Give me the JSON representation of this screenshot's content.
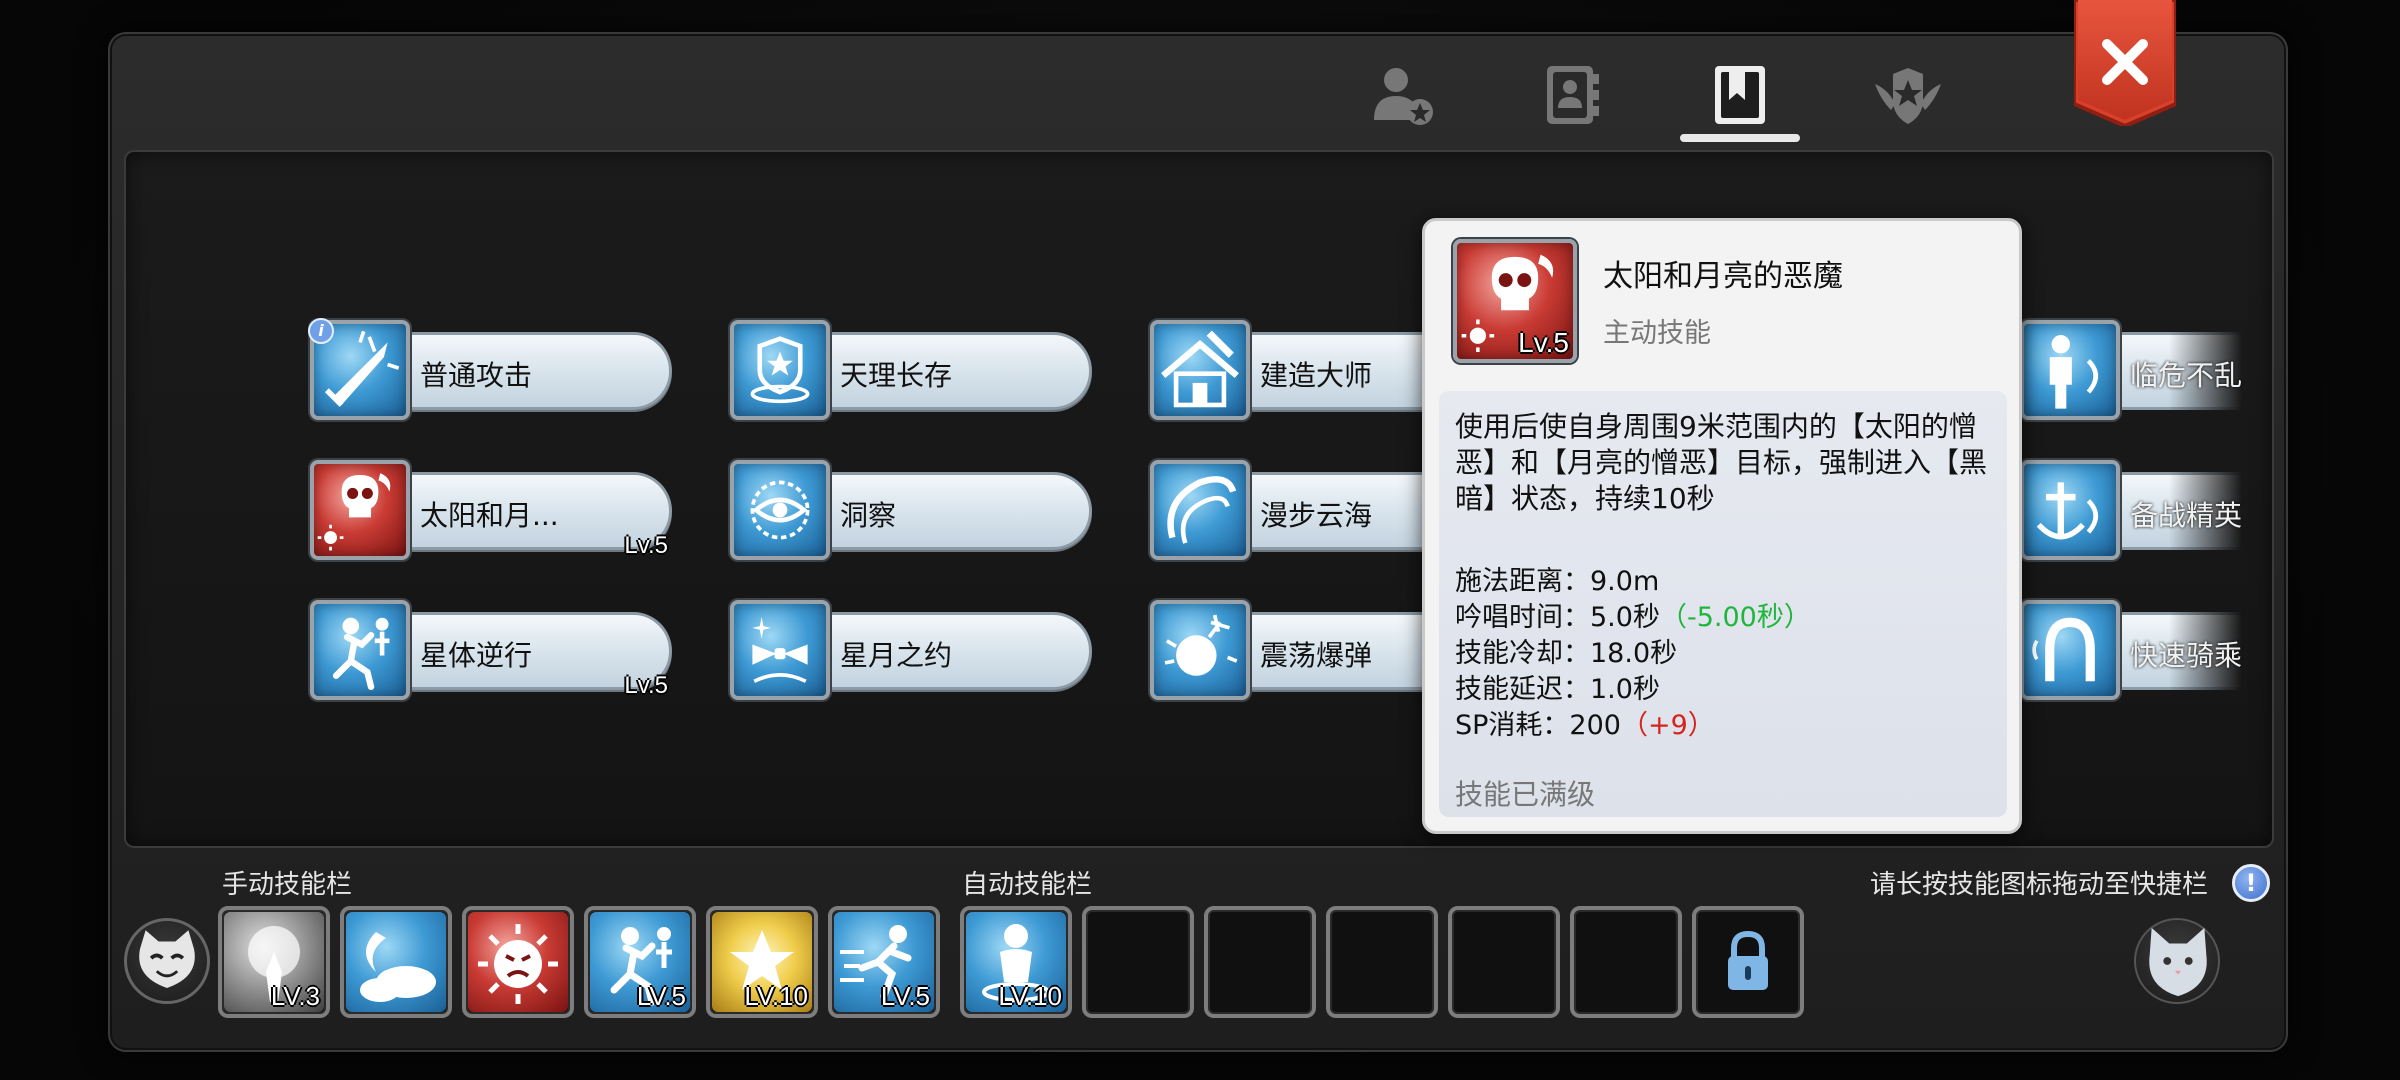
{
  "tabs": [
    {
      "icon": "person-star-icon"
    },
    {
      "icon": "contacts-book-icon"
    },
    {
      "icon": "bookmark-book-icon",
      "active": true
    },
    {
      "icon": "winged-emblem-icon"
    }
  ],
  "close_icon": "close-icon",
  "skills": [
    {
      "name": "普通攻击",
      "icon": "sword-burst-icon",
      "color": "blue",
      "level": "",
      "info": "i"
    },
    {
      "name": "天理长存",
      "icon": "star-shield-icon",
      "color": "blue",
      "level": ""
    },
    {
      "name": "建造大师",
      "icon": "house-hammer-icon",
      "color": "blue",
      "level": ""
    },
    {
      "name": "太阳和月...",
      "icon": "skull-moon-icon",
      "color": "red",
      "level": "Lv.5"
    },
    {
      "name": "洞察",
      "icon": "eye-burst-icon",
      "color": "blue",
      "level": ""
    },
    {
      "name": "漫步云海",
      "icon": "cloud-swirl-icon",
      "color": "blue",
      "level": ""
    },
    {
      "name": "星体逆行",
      "icon": "running-figure-icon",
      "color": "blue",
      "level": "Lv.5"
    },
    {
      "name": "星月之约",
      "icon": "bow-sparkle-icon",
      "color": "blue",
      "level": ""
    },
    {
      "name": "震荡爆弹",
      "icon": "bomb-burst-icon",
      "color": "blue",
      "level": ""
    },
    {
      "name": "临危不乱",
      "icon": "standing-figure-icon",
      "color": "blue",
      "level": ""
    },
    {
      "name": "备战精英",
      "icon": "anchor-swirl-icon",
      "color": "blue",
      "level": ""
    },
    {
      "name": "快速骑乘",
      "icon": "horseshoe-icon",
      "color": "blue",
      "level": ""
    }
  ],
  "tooltip": {
    "title": "太阳和月亮的恶魔",
    "type": "主动技能",
    "level": "Lv.5",
    "description": "使用后使自身周围9米范围内的【太阳的憎恶】和【月亮的憎恶】目标，强制进入【黑暗】状态，持续10秒",
    "cast_range_label": "施法距离：",
    "cast_range_value": "9.0m",
    "chant_label": "吟唱时间：",
    "chant_value": "5.0秒",
    "chant_bonus": "（-5.00秒）",
    "cooldown_label": "技能冷却：",
    "cooldown_value": "18.0秒",
    "delay_label": "技能延迟：",
    "delay_value": "1.0秒",
    "sp_label": "SP消耗：",
    "sp_value": "200",
    "sp_extra": "（+9）",
    "max_text": "技能已满级"
  },
  "manual_bar": {
    "label": "手动技能栏",
    "slots": [
      {
        "icon": "smoke-figure-icon",
        "color": "grey",
        "level": "LV.3"
      },
      {
        "icon": "moon-cloud-icon",
        "color": "blue",
        "level": ""
      },
      {
        "icon": "angry-sun-icon",
        "color": "red",
        "level": ""
      },
      {
        "icon": "running-figure-icon",
        "color": "blue",
        "level": "LV.5"
      },
      {
        "icon": "gold-star-icon",
        "color": "gold",
        "level": "LV.10"
      },
      {
        "icon": "dash-figure-icon",
        "color": "blue",
        "level": "LV.5"
      }
    ]
  },
  "auto_bar": {
    "label": "自动技能栏",
    "slots": [
      {
        "icon": "meditating-figure-icon",
        "color": "blue",
        "level": "LV.10"
      },
      {
        "empty": true
      },
      {
        "empty": true
      },
      {
        "empty": true
      },
      {
        "empty": true
      },
      {
        "empty": true
      },
      {
        "locked": true,
        "icon": "lock-icon"
      }
    ]
  },
  "hint": "请长按技能图标拖动至快捷栏",
  "help_glyph": "!",
  "colors": {
    "accent_red": "#d9402c",
    "green_bonus": "#1fb63c",
    "red_penalty": "#d6231e"
  }
}
